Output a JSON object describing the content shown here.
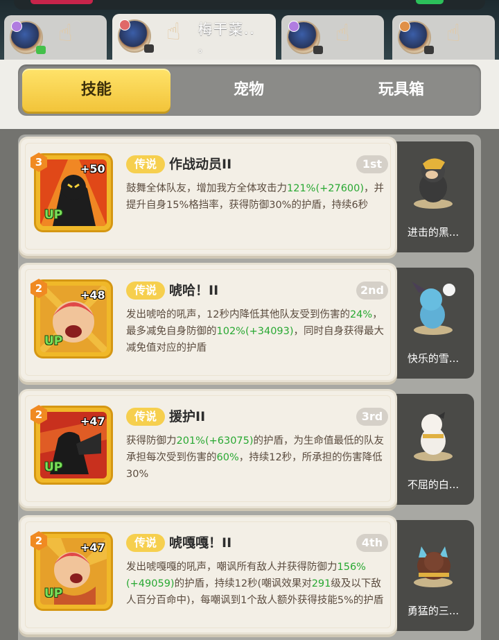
{
  "top_tabs": [
    {
      "label": "",
      "dot": ""
    },
    {
      "label": "梅干菜..",
      "dot": "。"
    },
    {
      "label": "",
      "dot": ""
    },
    {
      "label": "",
      "dot": ""
    }
  ],
  "segment_tabs": [
    "技能",
    "宠物",
    "玩具箱"
  ],
  "skills": [
    {
      "level": "3",
      "bonus": "+50",
      "up": "UP",
      "rarity": "传说",
      "name": "作战动员II",
      "rank": "1st",
      "desc": [
        {
          "t": "鼓舞全体队友，增加我方全体攻击力"
        },
        {
          "t": "121%(+27600)",
          "g": true
        },
        {
          "t": "，并提升自身15%格挡率，获得防御30%的护盾，持续6秒"
        }
      ],
      "pet_name": "进击的黑..."
    },
    {
      "level": "2",
      "bonus": "+48",
      "up": "UP",
      "rarity": "传说",
      "name": "唬哈！II",
      "rank": "2nd",
      "desc": [
        {
          "t": "发出唬哈的吼声，12秒内降低其他队友受到伤害的"
        },
        {
          "t": "24%",
          "g": true
        },
        {
          "t": "，最多减免自身防御的"
        },
        {
          "t": "102%(+34093)",
          "g": true
        },
        {
          "t": "，同时自身获得最大减免值对应的护盾"
        }
      ],
      "pet_name": "快乐的雪..."
    },
    {
      "level": "2",
      "bonus": "+47",
      "up": "UP",
      "rarity": "传说",
      "name": "援护II",
      "rank": "3rd",
      "desc": [
        {
          "t": "获得防御力"
        },
        {
          "t": "201%(+63075)",
          "g": true
        },
        {
          "t": "的护盾，为生命值最低的队友承担每次受到伤害的"
        },
        {
          "t": "60%",
          "g": true
        },
        {
          "t": "，持续12秒，所承担的伤害降低30%"
        }
      ],
      "pet_name": "不屈的白..."
    },
    {
      "level": "2",
      "bonus": "+47",
      "up": "UP",
      "rarity": "传说",
      "name": "唬嘎嘎！II",
      "rank": "4th",
      "desc": [
        {
          "t": "发出唬嘎嘎的吼声，嘲讽所有敌人并获得防御力"
        },
        {
          "t": "156%(+49059)",
          "g": true
        },
        {
          "t": "的护盾，持续12秒(嘲讽效果对"
        },
        {
          "t": "291",
          "g": true
        },
        {
          "t": "级及以下敌人百分百命中)，每嘲讽到1个敌人额外获得技能5%的护盾"
        }
      ],
      "pet_name": "勇猛的三..."
    }
  ],
  "colors": {
    "accent": "#f6cf4e",
    "highlight": "#28a832"
  }
}
